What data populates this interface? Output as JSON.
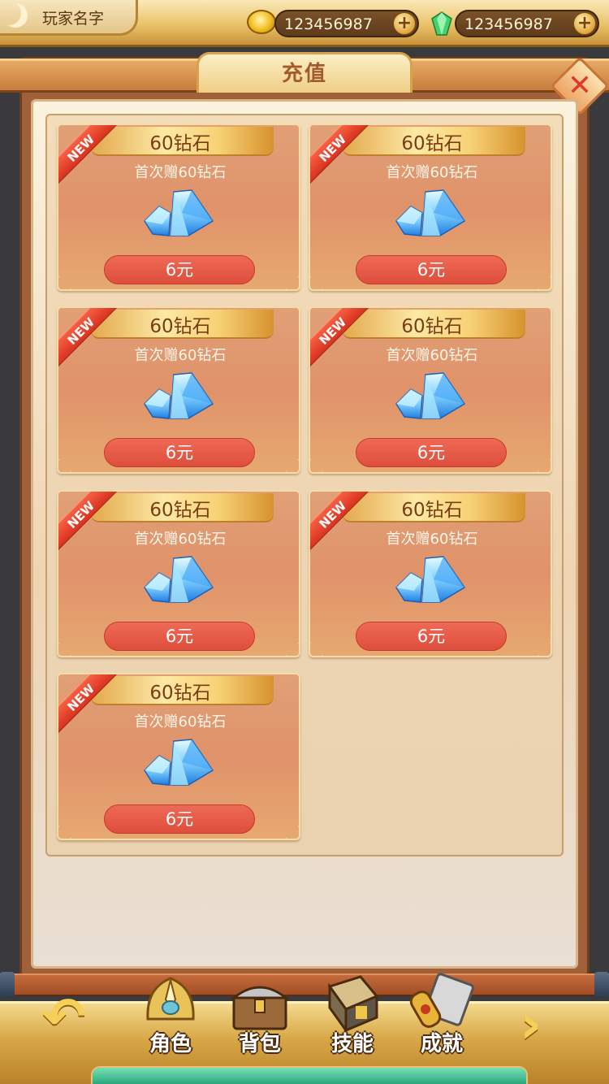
{
  "topbar": {
    "player_name": "玩家名字",
    "gold": {
      "amount": "123456987",
      "icon": "gold-coin-icon",
      "add_label": "+"
    },
    "gems": {
      "amount": "123456987",
      "icon": "green-gem-icon",
      "add_label": "+"
    }
  },
  "dialog": {
    "title": "充值",
    "close_label": "✕"
  },
  "products": [
    {
      "title": "60钻石",
      "subtitle": "首次赠60钻石",
      "price": "6元",
      "badge": "NEW"
    },
    {
      "title": "60钻石",
      "subtitle": "首次赠60钻石",
      "price": "6元",
      "badge": "NEW"
    },
    {
      "title": "60钻石",
      "subtitle": "首次赠60钻石",
      "price": "6元",
      "badge": "NEW"
    },
    {
      "title": "60钻石",
      "subtitle": "首次赠60钻石",
      "price": "6元",
      "badge": "NEW"
    },
    {
      "title": "60钻石",
      "subtitle": "首次赠60钻石",
      "price": "6元",
      "badge": "NEW"
    },
    {
      "title": "60钻石",
      "subtitle": "首次赠60钻石",
      "price": "6元",
      "badge": "NEW"
    },
    {
      "title": "60钻石",
      "subtitle": "首次赠60钻石",
      "price": "6元",
      "badge": "NEW"
    }
  ],
  "bottom_nav": {
    "back_label": "↶",
    "next_label": "›",
    "items": [
      {
        "label": "角色",
        "icon": "helmet-icon"
      },
      {
        "label": "背包",
        "icon": "chest-icon"
      },
      {
        "label": "技能",
        "icon": "skill-book-icon"
      },
      {
        "label": "成就",
        "icon": "scroll-icon"
      }
    ],
    "exp_fraction": 1.0
  },
  "colors": {
    "card_bg": "#e0926a",
    "price_button": "#e85c47",
    "badge": "#e2402a",
    "title": "#a55a2a"
  }
}
